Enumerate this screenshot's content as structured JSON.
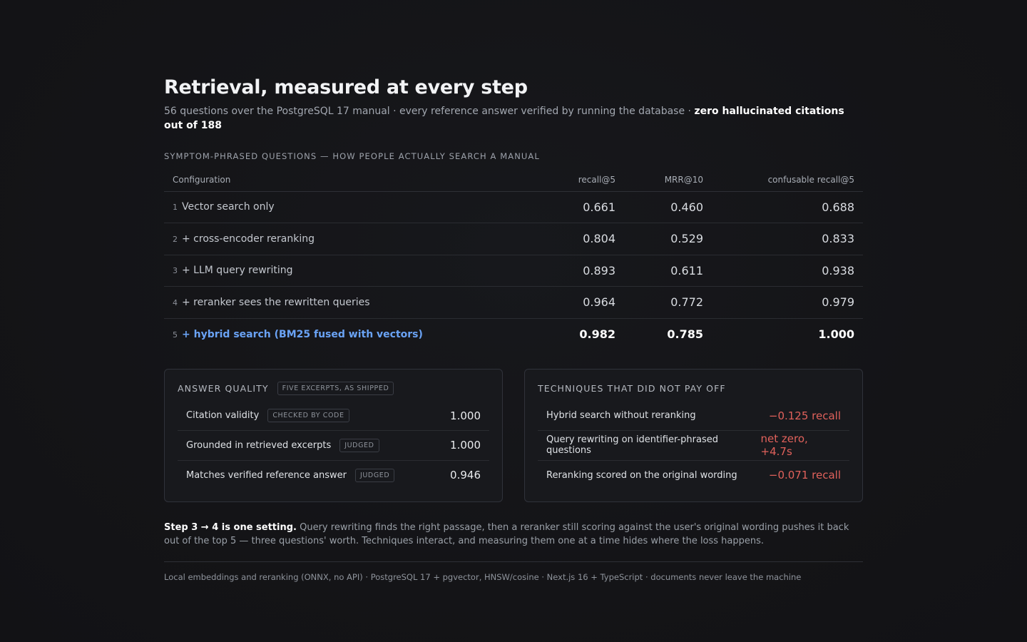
{
  "header": {
    "title": "Retrieval, measured at every step",
    "subtitle": "56 questions over the PostgreSQL 17 manual · every reference answer verified by running the database · ",
    "subtitle_strong": "zero hallucinated citations out of 188"
  },
  "section_label": "Symptom-phrased questions — how people actually search a manual",
  "table": {
    "columns": [
      "Configuration",
      "recall@5",
      "MRR@10",
      "confusable recall@5"
    ],
    "rows": [
      {
        "idx": "1",
        "config": "Vector search only",
        "recall5": "0.661",
        "mrr10": "0.460",
        "confusable": "0.688"
      },
      {
        "idx": "2",
        "config": "+ cross-encoder reranking",
        "recall5": "0.804",
        "mrr10": "0.529",
        "confusable": "0.833"
      },
      {
        "idx": "3",
        "config": "+ LLM query rewriting",
        "recall5": "0.893",
        "mrr10": "0.611",
        "confusable": "0.938"
      },
      {
        "idx": "4",
        "config": "+ reranker sees the rewritten queries",
        "recall5": "0.964",
        "mrr10": "0.772",
        "confusable": "0.979"
      },
      {
        "idx": "5",
        "config": "+ hybrid search (BM25 fused with vectors)",
        "recall5": "0.982",
        "mrr10": "0.785",
        "confusable": "1.000"
      }
    ]
  },
  "answer_quality": {
    "title": "Answer quality",
    "tag": "Five excerpts, as shipped",
    "rows": [
      {
        "label": "Citation validity",
        "tag": "Checked by code",
        "value": "1.000"
      },
      {
        "label": "Grounded in retrieved excerpts",
        "tag": "Judged",
        "value": "1.000"
      },
      {
        "label": "Matches verified reference answer",
        "tag": "Judged",
        "value": "0.946"
      }
    ]
  },
  "techniques": {
    "title": "Techniques that did not pay off",
    "rows": [
      {
        "label": "Hybrid search without reranking",
        "value": "−0.125 recall"
      },
      {
        "label": "Query rewriting on identifier-phrased questions",
        "value": "net zero, +4.7s"
      },
      {
        "label": "Reranking scored on the original wording",
        "value": "−0.071 recall"
      }
    ]
  },
  "note": {
    "strong": "Step 3 → 4 is one setting.",
    "text": " Query rewriting finds the right passage, then a reranker still scoring against the user's original wording pushes it back out of the top 5 — three questions' worth. Techniques interact, and measuring them one at a time hides where the loss happens."
  },
  "footer": "Local embeddings and reranking (ONNX, no API) · PostgreSQL 17 + pgvector, HNSW/cosine · Next.js 16 + TypeScript · documents never leave the machine",
  "colors": {
    "background": "#141417",
    "accent_blue": "#6aa3f5",
    "negative_red": "#e0615b"
  }
}
